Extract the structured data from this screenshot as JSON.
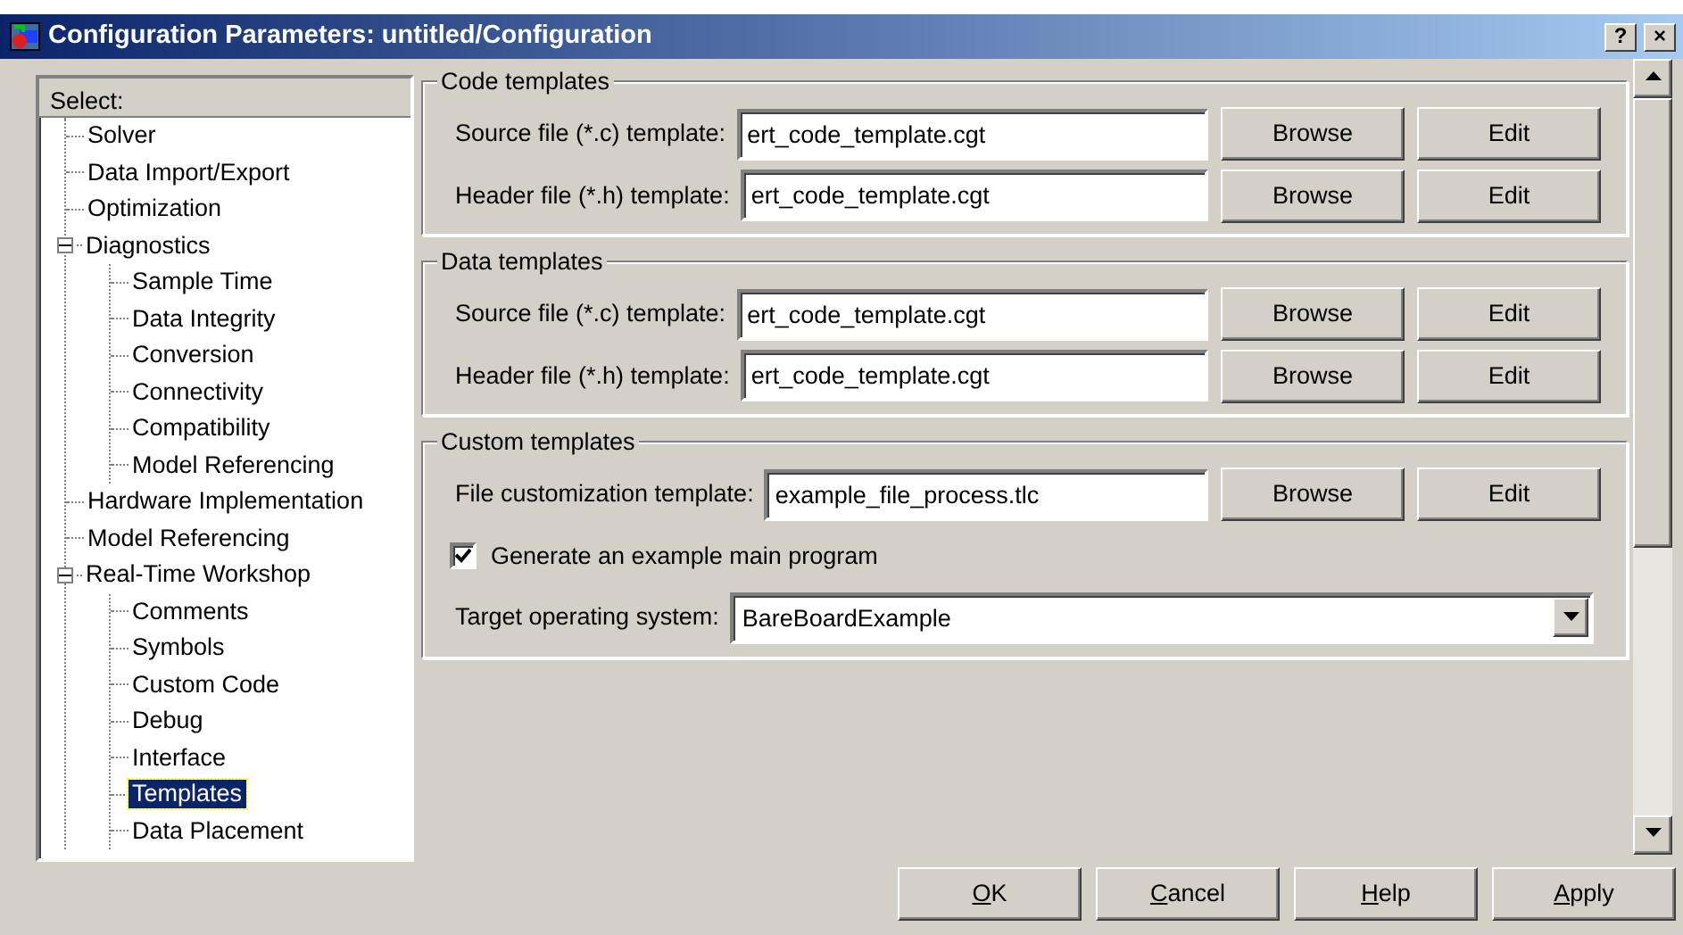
{
  "window": {
    "title": "Configuration Parameters: untitled/Configuration",
    "help_button": "?",
    "close_button": "×"
  },
  "tree": {
    "header": "Select:",
    "items": [
      {
        "label": "Solver",
        "selected": false
      },
      {
        "label": "Data Import/Export",
        "selected": false
      },
      {
        "label": "Optimization",
        "selected": false
      },
      {
        "label": "Diagnostics",
        "selected": false,
        "expanded": true,
        "children": [
          {
            "label": "Sample Time",
            "selected": false
          },
          {
            "label": "Data Integrity",
            "selected": false
          },
          {
            "label": "Conversion",
            "selected": false
          },
          {
            "label": "Connectivity",
            "selected": false
          },
          {
            "label": "Compatibility",
            "selected": false
          },
          {
            "label": "Model Referencing",
            "selected": false
          }
        ]
      },
      {
        "label": "Hardware Implementation",
        "selected": false
      },
      {
        "label": "Model Referencing",
        "selected": false
      },
      {
        "label": "Real-Time Workshop",
        "selected": false,
        "expanded": true,
        "children": [
          {
            "label": "Comments",
            "selected": false
          },
          {
            "label": "Symbols",
            "selected": false
          },
          {
            "label": "Custom Code",
            "selected": false
          },
          {
            "label": "Debug",
            "selected": false
          },
          {
            "label": "Interface",
            "selected": false
          },
          {
            "label": "Templates",
            "selected": true
          },
          {
            "label": "Data Placement",
            "selected": false
          }
        ]
      }
    ]
  },
  "groups": [
    {
      "title": "Code templates",
      "rows": [
        {
          "kind": "file",
          "label": "Source file (*.c) template:",
          "value": "ert_code_template.cgt",
          "buttons": [
            "Browse",
            "Edit"
          ]
        },
        {
          "kind": "file",
          "label": "Header file (*.h) template:",
          "value": "ert_code_template.cgt",
          "buttons": [
            "Browse",
            "Edit"
          ]
        }
      ]
    },
    {
      "title": "Data templates",
      "rows": [
        {
          "kind": "file",
          "label": "Source file (*.c) template:",
          "value": "ert_code_template.cgt",
          "buttons": [
            "Browse",
            "Edit"
          ]
        },
        {
          "kind": "file",
          "label": "Header file (*.h) template:",
          "value": "ert_code_template.cgt",
          "buttons": [
            "Browse",
            "Edit"
          ]
        }
      ]
    },
    {
      "title": "Custom templates",
      "rows": [
        {
          "kind": "file",
          "label": "File customization template:",
          "value": "example_file_process.tlc",
          "buttons": [
            "Browse",
            "Edit"
          ]
        },
        {
          "kind": "checkbox",
          "label": "Generate an example main program",
          "checked": true
        },
        {
          "kind": "dropdown",
          "label": "Target operating system:",
          "value": "BareBoardExample"
        }
      ]
    }
  ],
  "footer_buttons": [
    {
      "label": "OK",
      "mnemonic": true
    },
    {
      "label": "Cancel",
      "mnemonic": true
    },
    {
      "label": "Help",
      "mnemonic": true
    },
    {
      "label": "Apply",
      "mnemonic": true
    }
  ]
}
